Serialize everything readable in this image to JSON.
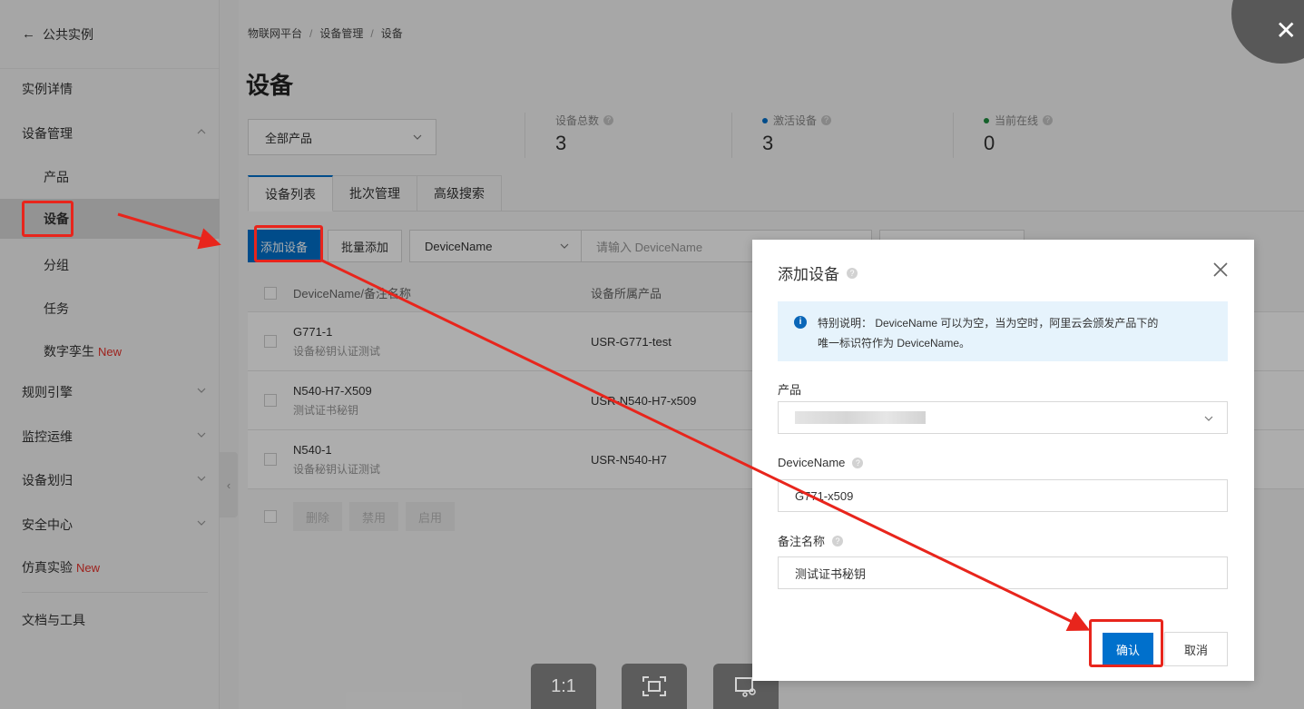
{
  "sidebar": {
    "back_label": "公共实例",
    "items": [
      {
        "label": "实例详情"
      },
      {
        "label": "设备管理"
      },
      {
        "label": "产品"
      },
      {
        "label": "设备"
      },
      {
        "label": "分组"
      },
      {
        "label": "任务"
      },
      {
        "label": "数字孪生",
        "badge": "New"
      },
      {
        "label": "规则引擎"
      },
      {
        "label": "监控运维"
      },
      {
        "label": "设备划归"
      },
      {
        "label": "安全中心"
      },
      {
        "label": "仿真实验",
        "badge": "New"
      },
      {
        "label": "文档与工具"
      }
    ]
  },
  "breadcrumb": [
    "物联网平台",
    "设备管理",
    "设备"
  ],
  "page_title": "设备",
  "product_filter": {
    "value": "全部产品"
  },
  "stats": [
    {
      "label": "设备总数",
      "value": "3"
    },
    {
      "label": "激活设备",
      "value": "3",
      "dot_color": "#0070cc"
    },
    {
      "label": "当前在线",
      "value": "0",
      "dot_color": "#1e8e3e"
    }
  ],
  "tabs": [
    "设备列表",
    "批次管理",
    "高级搜索"
  ],
  "toolbar": {
    "add_label": "添加设备",
    "batch_label": "批量添加",
    "filter_field": "DeviceName",
    "search_placeholder": "请输入 DeviceName"
  },
  "table": {
    "headers": [
      "DeviceName/备注名称",
      "设备所属产品"
    ],
    "rows": [
      {
        "name": "G771-1",
        "note": "设备秘钥认证测试",
        "product": "USR-G771-test"
      },
      {
        "name": "N540-H7-X509",
        "note": "测试证书秘钥",
        "product": "USR-N540-H7-x509"
      },
      {
        "name": "N540-1",
        "note": "设备秘钥认证测试",
        "product": "USR-N540-H7"
      }
    ],
    "footer_buttons": [
      "删除",
      "禁用",
      "启用"
    ]
  },
  "viewer": {
    "ratio_label": "1:1"
  },
  "modal": {
    "title": "添加设备",
    "notice_line1": "特别说明： DeviceName 可以为空，当为空时，阿里云会颁发产品下的",
    "notice_line2": "唯一标识符作为 DeviceName。",
    "product_label": "产品",
    "devicename_label": "DeviceName",
    "devicename_value": "G771-x509",
    "note_label": "备注名称",
    "note_value": "测试证书秘钥",
    "confirm_label": "确认",
    "cancel_label": "取消"
  },
  "colors": {
    "accent": "#0070cc",
    "annotation": "#e8251c",
    "badge_new": "#e8312a"
  }
}
